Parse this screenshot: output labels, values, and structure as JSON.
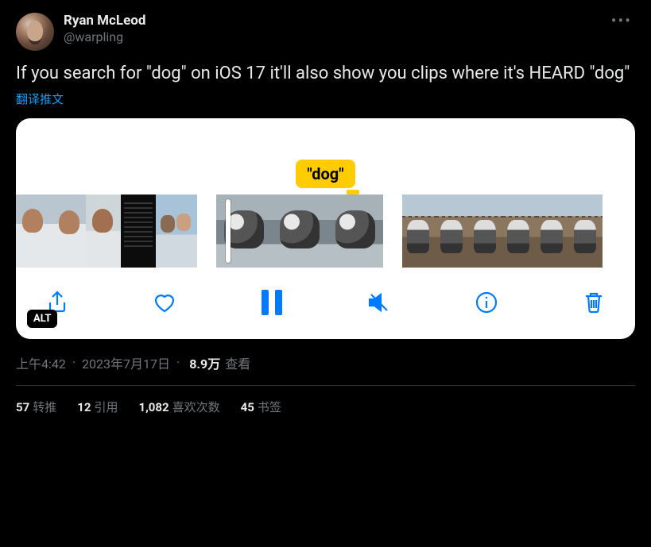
{
  "author": {
    "display_name": "Ryan McLeod",
    "handle": "@warpling"
  },
  "tweet_text": "If you search for \"dog\" on iOS 17 it'll also show you clips where it's HEARD \"dog\"",
  "translate_label": "翻译推文",
  "media": {
    "caption_bubble": "\"dog\"",
    "alt_badge": "ALT"
  },
  "meta": {
    "time": "上午4:42",
    "date": "2023年7月17日",
    "views_number": "8.9万",
    "views_label": "查看"
  },
  "stats": {
    "retweets_count": "57",
    "retweets_label": "转推",
    "quotes_count": "12",
    "quotes_label": "引用",
    "likes_count": "1,082",
    "likes_label": "喜欢次数",
    "bookmarks_count": "45",
    "bookmarks_label": "书签"
  }
}
